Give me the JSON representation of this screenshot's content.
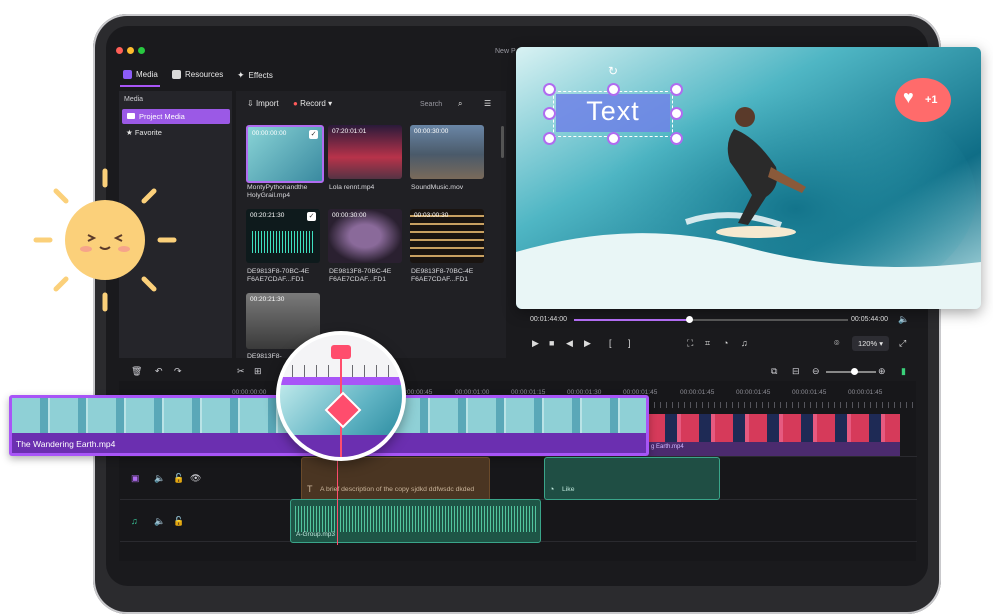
{
  "window": {
    "title": "New P"
  },
  "tabs": [
    {
      "label": "Media"
    },
    {
      "label": "Resources"
    },
    {
      "label": "Effects"
    }
  ],
  "sidebar": {
    "title": "Media",
    "items": [
      {
        "label": "Project Media"
      },
      {
        "label": "Favorite"
      }
    ]
  },
  "media_toolbar": {
    "import_label": "Import",
    "record_label": "Record",
    "search_placeholder": "Search"
  },
  "media_items": [
    {
      "duration": "00:00:00:00",
      "name": "MontyPythonandthe HolyGrail.mp4",
      "checked": true
    },
    {
      "duration": "07:20:01:01",
      "name": "Lola rennt.mp4",
      "checked": false
    },
    {
      "duration": "00:00:30:00",
      "name": "SoundMusic.mov",
      "checked": false
    },
    {
      "duration": "00:20:21:30",
      "name": "DE9813F8-70BC-4E F6AE7CDAF...FD1",
      "checked": true
    },
    {
      "duration": "00:00:30:00",
      "name": "DE9813F8-70BC-4E F6AE7CDAF...FD1",
      "checked": false
    },
    {
      "duration": "00:03:00:30",
      "name": "DE9813F8-70BC-4E F6AE7CDAF...FD1",
      "checked": false
    },
    {
      "duration": "00:20:21:30",
      "name": "DE9813F8-",
      "checked": false
    }
  ],
  "preview": {
    "overlay_text": "Text",
    "current_time": "00:01:44:00",
    "total_time": "00:05:44:00",
    "progress": 0.42,
    "zoom": "120%",
    "sticker_text": "+1"
  },
  "timeline": {
    "timecodes": [
      "00:00:00:00",
      "00:00:00:45",
      "00:00:01:00",
      "00:00:01:15",
      "00:00:01:30",
      "00:00:01:45",
      "00:00:01:45",
      "00:00:01:45",
      "00:00:01:45",
      "00:00:01:45"
    ],
    "main_clip": "The Wandering Earth.mp4",
    "second_clip": "g Earth.mp4",
    "text_clip": "A brief description of the copy sjdkd ddfwsdc dkded",
    "sticker_clip": "Like",
    "audio_clip": "A-Group.mp3"
  },
  "colors": {
    "accent": "#a855f7",
    "playhead": "#ff4d6d",
    "audio": "#3aa58a",
    "text_clip": "#4a3522"
  }
}
